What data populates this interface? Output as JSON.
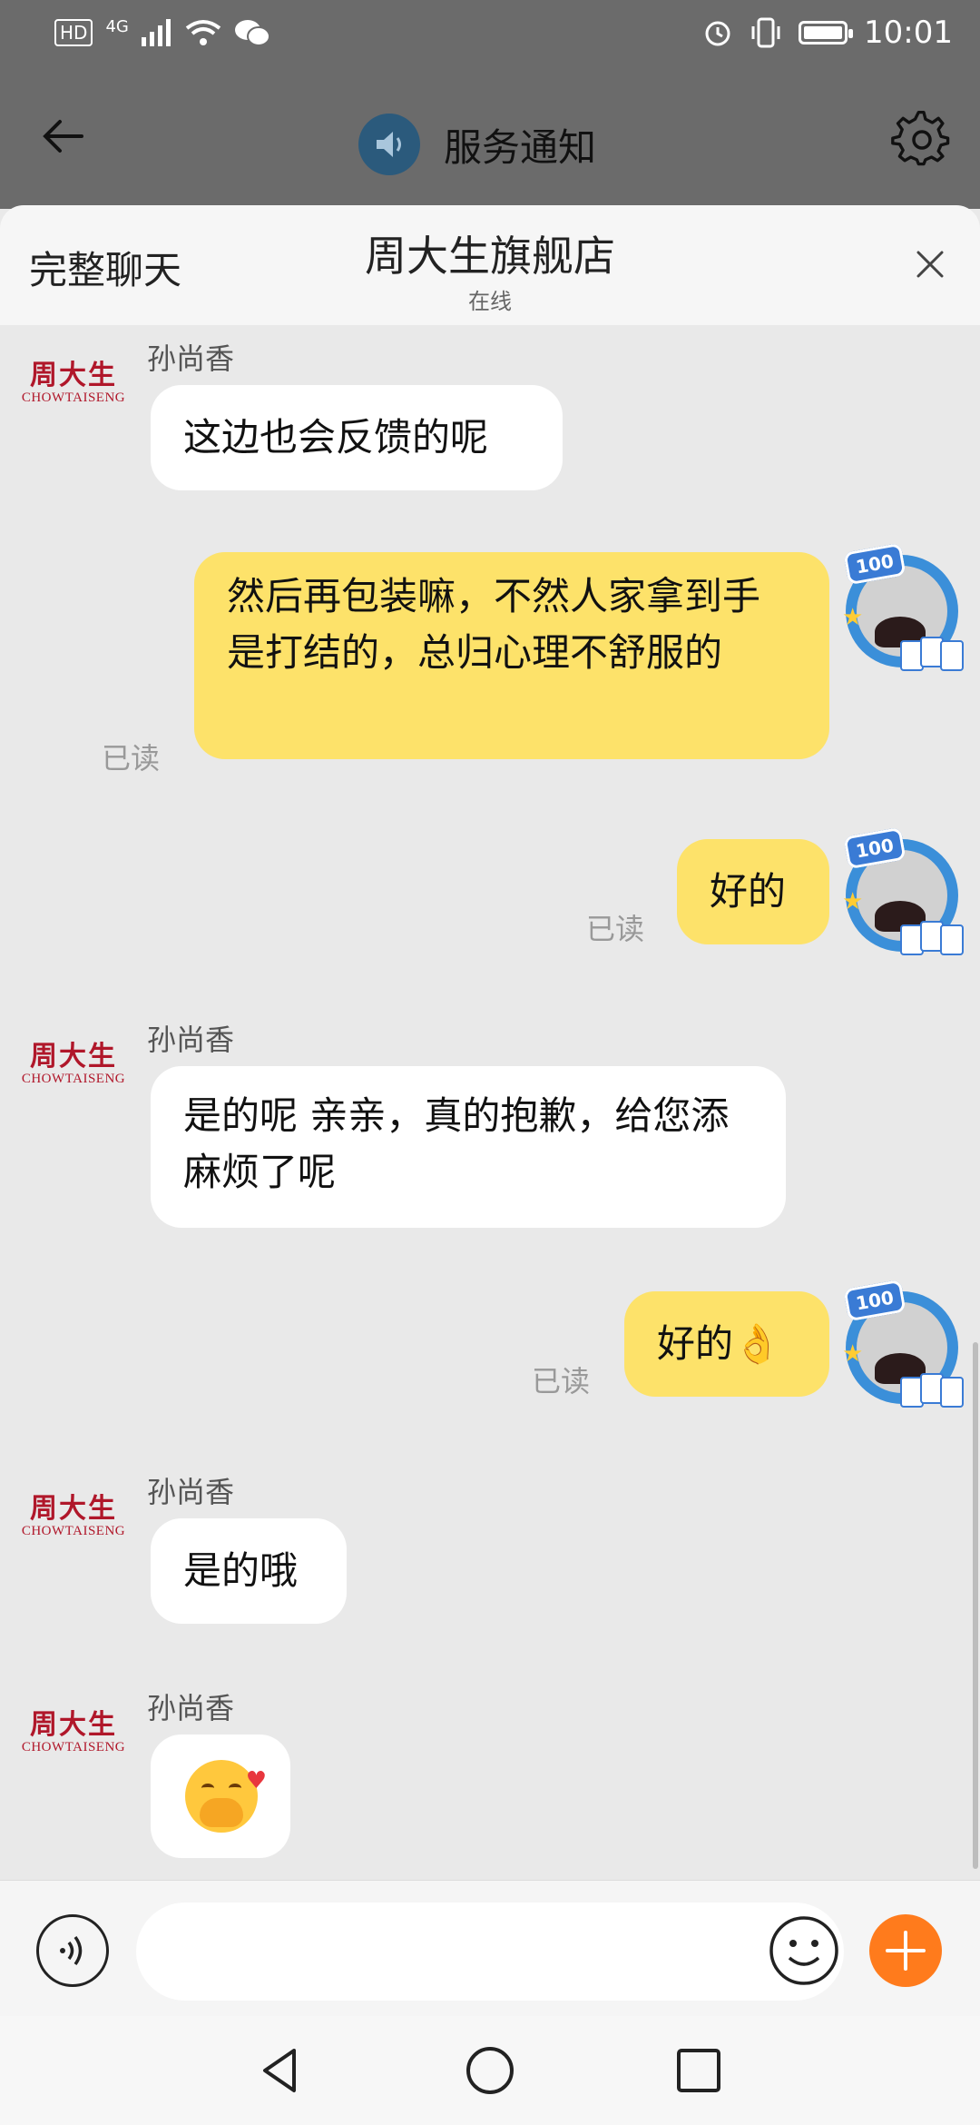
{
  "status_bar": {
    "network_badge": "HD",
    "network_type": "4G",
    "time": "10:01"
  },
  "app_bar": {
    "title": "服务通知"
  },
  "sheet": {
    "full_chat_label": "完整聊天",
    "title": "周大生旗舰店",
    "status": "在线"
  },
  "shop_logo": {
    "cn": "周大生",
    "en": "CHOWTAISENG"
  },
  "messages": [
    {
      "side": "in",
      "sender": "孙尚香",
      "text": "这边也会反馈的呢"
    },
    {
      "side": "out",
      "text": "然后再包装嘛，不然人家拿到手是打结的，总归心理不舒服的",
      "read": "已读"
    },
    {
      "side": "out",
      "text": "好的",
      "read": "已读"
    },
    {
      "side": "in",
      "sender": "孙尚香",
      "text": "是的呢 亲亲，真的抱歉，给您添麻烦了呢"
    },
    {
      "side": "out",
      "text": "好的👌",
      "read": "已读"
    },
    {
      "side": "in",
      "sender": "孙尚香",
      "text": "是的哦"
    },
    {
      "side": "in",
      "sender": "孙尚香",
      "text": "🤭",
      "type": "emoji"
    }
  ],
  "avatar_badge": "100",
  "input": {
    "placeholder": ""
  },
  "icons": {
    "back": "arrow-left-icon",
    "speaker": "speaker-icon",
    "settings": "gear-icon",
    "close": "close-icon",
    "voice": "voice-wave-icon",
    "emoji": "smiley-icon",
    "plus": "plus-icon",
    "nav_back": "triangle-back-icon",
    "nav_home": "circle-home-icon",
    "nav_recent": "square-recent-icon"
  },
  "colors": {
    "status_bg": "#6b6b6b",
    "bubble_out": "#fde26a",
    "bubble_in": "#ffffff",
    "plus": "#ff7b1c",
    "logo_red": "#b0172a"
  }
}
